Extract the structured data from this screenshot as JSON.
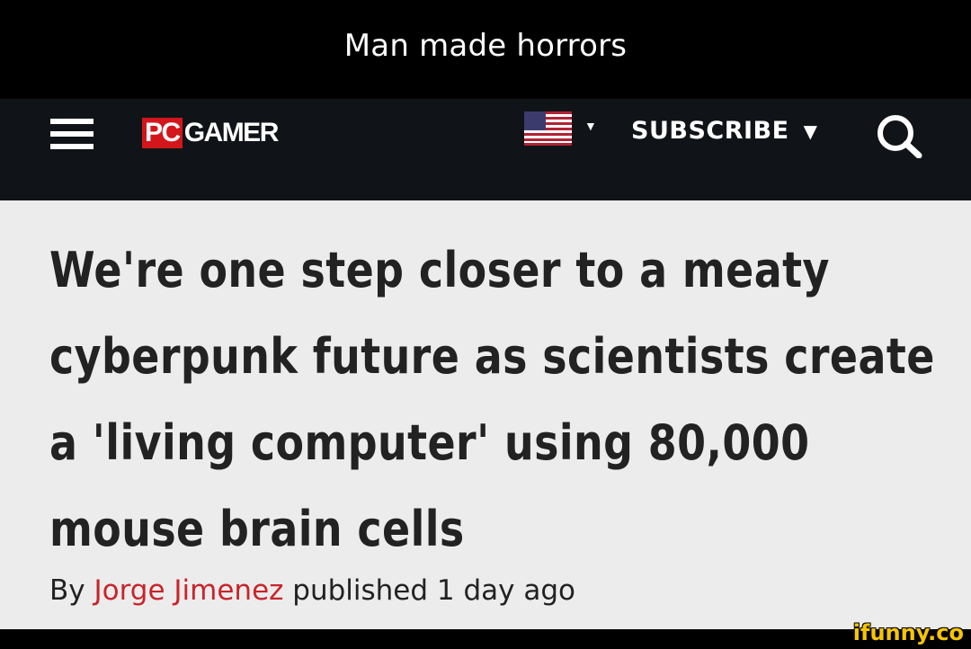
{
  "caption": "Man made horrors",
  "header": {
    "logo": {
      "pc": "PC",
      "gamer": "GAMER"
    },
    "region_caret": "▼",
    "subscribe_label": "SUBSCRIBE",
    "subscribe_caret": "▼",
    "icons": {
      "menu": "hamburger-menu-icon",
      "flag": "us-flag-icon",
      "search": "search-icon"
    }
  },
  "article": {
    "headline": "We're one step closer to a meaty cyberpunk future as scientists create a 'living computer' using 80,000 mouse brain cells",
    "byline": {
      "prefix": "By",
      "author": "Jorge Jimenez",
      "published": "published 1 day ago"
    }
  },
  "watermark": "ifunny.co",
  "colors": {
    "caption_bg": "#000000",
    "header_bg": "#101418",
    "brand_red": "#d3161b",
    "author_link": "#c8242b",
    "page_bg": "#ececec",
    "headline_text": "#222222",
    "watermark": "#f7c600"
  }
}
